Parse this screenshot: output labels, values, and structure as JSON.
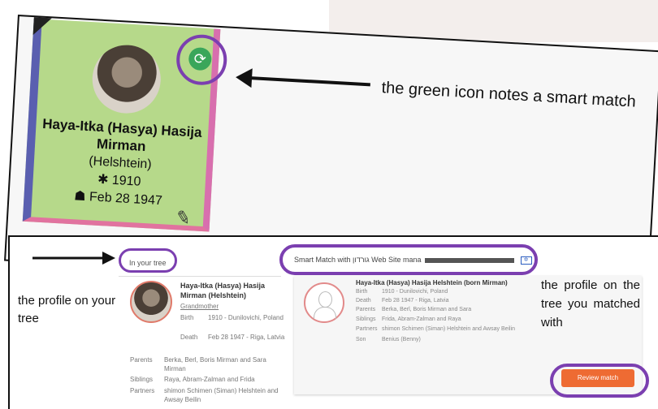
{
  "top_card": {
    "name": "Haya-Itka (Hasya) Hasija Mirman",
    "maiden": "(Helshtein)",
    "birth": "✱ 1910",
    "death": "☗ Feb 28 1947",
    "smart_icon_glyph": "⟳",
    "pencil_glyph": "✎"
  },
  "annotations": {
    "smart_match_note": "the green icon notes a smart match",
    "profile_on_your_tree": "the profile on your tree",
    "profile_matched_with": "the profile on the tree you matched with"
  },
  "left_profile": {
    "header": "In your tree",
    "name": "Haya-Itka (Hasya) Hasija Mirman (Helshtein)",
    "relationship": "Grandmother",
    "birth_label": "Birth",
    "birth_value": "1910 - Dunilovichi, Poland",
    "death_label": "Death",
    "death_value": "Feb 28 1947 - Riga, Latvia",
    "parents_label": "Parents",
    "parents_value": "Berka, Berl, Boris Mirman and Sara Mirman",
    "siblings_label": "Siblings",
    "siblings_value": "Raya, Abram-Zalman and Frida",
    "partners_label": "Partners",
    "partners_value": "shimon Schimen (Siman) Helshtein and Awsay Beilin"
  },
  "right_profile": {
    "header": "Smart Match with גורדון Web Site mana",
    "name": "Haya-Itka (Hasya) Hasija Helshtein (born Mirman)",
    "rows": [
      {
        "label": "Birth",
        "value": "1910 - Dunilovichi, Poland"
      },
      {
        "label": "Death",
        "value": "Feb 28 1947 - Riga, Latvia"
      },
      {
        "label": "Parents",
        "value": "Berka, Berl, Boris Mirman and Sara"
      },
      {
        "label": "Siblings",
        "value": "Frida, Abram-Zalman and Raya"
      },
      {
        "label": "Partners",
        "value": "shimon Schimen (Siman) Helshtein and Awsay Beilin"
      },
      {
        "label": "Son",
        "value": "Benius (Benny)"
      }
    ],
    "review_button": "Review match"
  },
  "colors": {
    "card_green": "#b6d98a",
    "highlight_purple": "#7b3fb0",
    "smart_match_green": "#3aa65a",
    "review_orange": "#ee6b33"
  }
}
